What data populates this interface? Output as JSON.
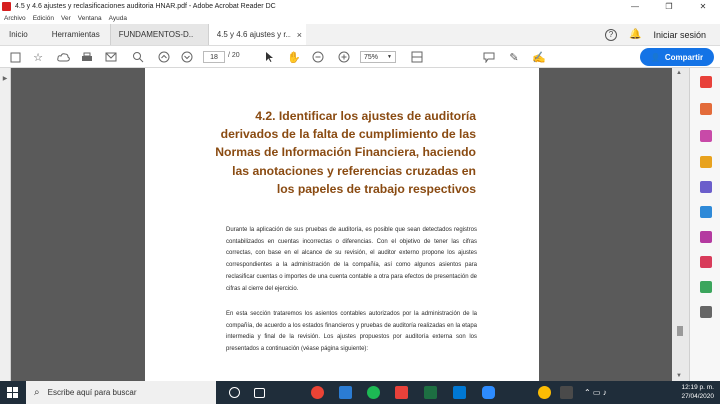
{
  "window": {
    "title": "4.5 y 4.6 ajustes y reclasificaciones auditoria HNAR.pdf - Adobe Acrobat Reader DC",
    "minimize": "—",
    "maximize": "❐",
    "close": "✕"
  },
  "menu": [
    "Archivo",
    "Edición",
    "Ver",
    "Ventana",
    "Ayuda"
  ],
  "tabs": {
    "home": "Inicio",
    "tools": "Herramientas",
    "doc1": "FUNDAMENTOS-D...",
    "doc2": "4.5 y 4.6 ajustes y r...",
    "close": "×"
  },
  "header_right": {
    "help": "?",
    "signin": "Iniciar sesión"
  },
  "toolbar": {
    "page_current": "18",
    "page_total": "/ 20",
    "zoom": "75%",
    "share": "Compartir"
  },
  "document": {
    "heading": "4.2. Identificar los ajustes de auditoría derivados de la falta de cumplimiento de las Normas de Información Financiera, haciendo las anotaciones y referencias cruzadas en los papeles de trabajo respectivos",
    "para1": "Durante la aplicación de sus pruebas de auditoría, es posible que sean detectados registros contabilizados en cuentas incorrectas o diferencias. Con el objetivo de tener las cifras correctas, con base en el alcance de su revisión, el auditor externo propone los ajustes correspondientes a la administración de la compañía, así como algunos asientos para reclasificar cuentas o importes de una cuenta contable a otra para efectos de presentación de cifras al cierre del ejercicio.",
    "para2": "En esta sección trataremos los asientos contables autorizados por la administración de la compañía, de acuerdo a los estados financieros y pruebas de auditoría realizadas en la etapa intermedia y final de la revisión.  Los ajustes propuestos por auditoría externa son los presentados a continuación (véase página siguiente):"
  },
  "taskbar": {
    "search_placeholder": "Escribe aquí para buscar",
    "time": "12:19 p. m.",
    "date": "27/04/2020"
  },
  "colors": {
    "heading": "#8a4b12",
    "share": "#1473e6",
    "taskbar": "#1f2d3a"
  }
}
